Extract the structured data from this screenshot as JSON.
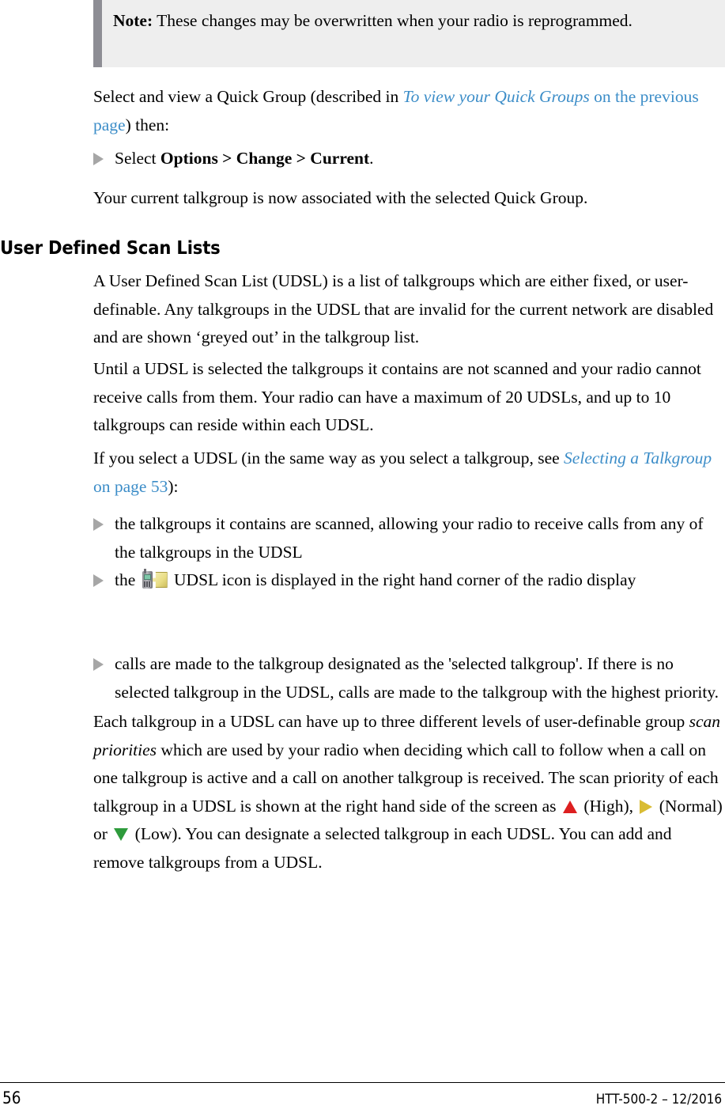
{
  "note": {
    "label": "Note:",
    "text": "These changes may be overwritten when your radio is reprogrammed."
  },
  "paragraphs": {
    "intro_pre": "Select and view a Quick Group (described in ",
    "intro_link_italic": "To view your Quick Groups",
    "intro_link_plain": " on the previous page",
    "intro_post": ") then:",
    "step_pre": "Select ",
    "step_bold": "Options > Change > Current",
    "step_post": ".",
    "assoc": "Your current talkgroup is now associated with the selected Quick Group.",
    "udsl_def": "A User Defined Scan List (UDSL) is a list of talkgroups which are either fixed, or user-definable. Any talkgroups in the UDSL that are invalid for the current network are disabled and are shown ‘greyed out’ in the talkgroup list.",
    "udsl_until": "Until a UDSL is selected the talkgroups it contains are not scanned and your radio cannot receive calls from them. Your radio can have a maximum of 20 UDSLs, and up to 10 talkgroups can reside within each UDSL.",
    "select_pre": "If you select a UDSL (in the same way as you select a talkgroup, see ",
    "select_link_italic": "Selecting a Talkgroup",
    "select_link_plain": " on page 53",
    "select_post": "):",
    "priorities_1": "Each talkgroup in a UDSL can have up to three different levels of user-definable group ",
    "priorities_italic": "scan priorities",
    "priorities_2": " which are used by your radio when deciding which call to follow when a call on one talkgroup is active and a call on another talkgroup is received. The scan priority of each talkgroup in a UDSL is shown at the right hand side of the screen as ",
    "priorities_high": " (High), ",
    "priorities_normal": " (Normal) or ",
    "priorities_low": " (Low). You can designate a selected talkgroup in each UDSL. You can add and remove talkgroups from a UDSL."
  },
  "heading": {
    "user_defined_scan_lists": "User Defined Scan Lists"
  },
  "bullets": {
    "b1": "the talkgroups it contains are scanned, allowing your radio to receive calls from any of the talkgroups in the UDSL",
    "b2_pre": "the ",
    "b2_post": " UDSL icon is displayed in the right hand corner of the radio display",
    "b3": "calls are made to the talkgroup designated as the 'selected talkgroup'. If there is no selected talkgroup in the UDSL, calls are made to the talkgroup with the highest priority."
  },
  "footer": {
    "page_number": "56",
    "document_id": "HTT-500-2 – 12/2016"
  },
  "colors": {
    "link": "#3c8dc8",
    "note_background": "#eeeeee",
    "note_bar": "#8d8d94",
    "bullet": "#a6a6a6",
    "priority_high": "#dd1f20",
    "priority_normal": "#d9bc34",
    "priority_low": "#2e9b3c"
  }
}
